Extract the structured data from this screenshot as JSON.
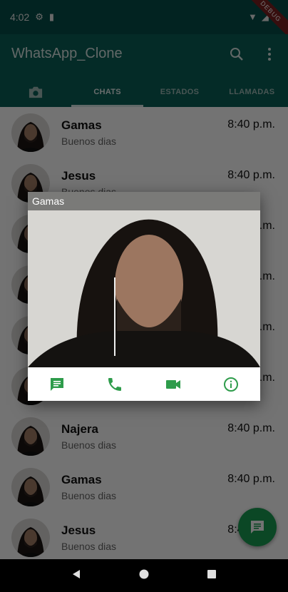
{
  "status": {
    "time": "4:02",
    "debug": "DEBUG"
  },
  "app": {
    "title": "WhatsApp_Clone"
  },
  "tabs": [
    "CHATS",
    "ESTADOS",
    "LLAMADAS"
  ],
  "chats": [
    {
      "name": "Gamas",
      "message": "Buenos dias",
      "time": "8:40 p.m."
    },
    {
      "name": "Jesus",
      "message": "Buenos dias",
      "time": "8:40 p.m."
    },
    {
      "name": "",
      "message": "",
      "time": "8:40 p.m."
    },
    {
      "name": "",
      "message": "",
      "time": "8:40 p.m."
    },
    {
      "name": "",
      "message": "",
      "time": "8:40 p.m."
    },
    {
      "name": "",
      "message": "",
      "time": "8:40 p.m."
    },
    {
      "name": "Najera",
      "message": "Buenos dias",
      "time": "8:40 p.m."
    },
    {
      "name": "Gamas",
      "message": "Buenos dias",
      "time": "8:40 p.m."
    },
    {
      "name": "Jesus",
      "message": "Buenos dias",
      "time": "8:40 p.m."
    }
  ],
  "popup": {
    "name": "Gamas"
  },
  "icons": {
    "search": "search-icon",
    "menu": "more-vert-icon",
    "camera": "camera-icon",
    "message": "message-icon",
    "call": "phone-icon",
    "video": "videocam-icon",
    "info": "info-icon",
    "fab": "chat-icon"
  },
  "colors": {
    "primary": "#075E54",
    "accent": "#25D366",
    "icon_green": "#2e9c4b"
  }
}
